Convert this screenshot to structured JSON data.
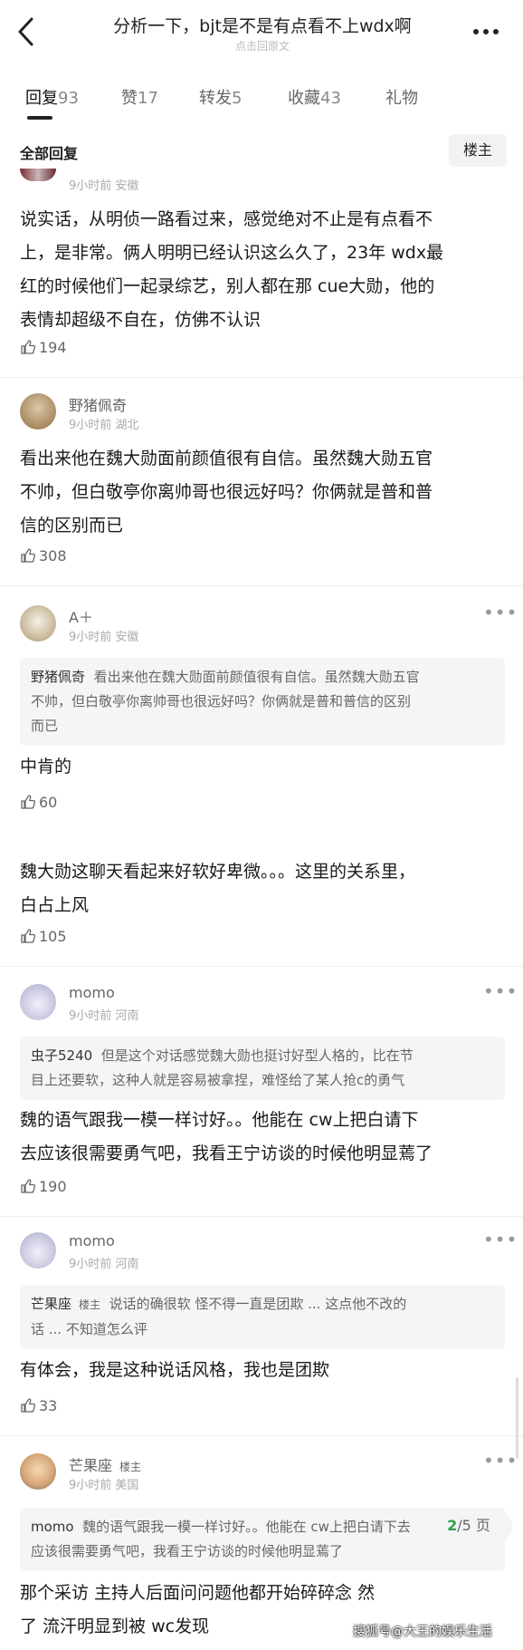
{
  "header": {
    "title": "分析一下，bjt是不是有点看不上wdx啊",
    "subtitle": "点击回原文"
  },
  "tabs": [
    {
      "label": "回复",
      "count": "93"
    },
    {
      "label": "赞",
      "count": "17"
    },
    {
      "label": "转发",
      "count": "5"
    },
    {
      "label": "收藏",
      "count": "43"
    },
    {
      "label": "礼物",
      "count": ""
    }
  ],
  "section": {
    "title": "全部回复",
    "louzhu_button": "楼主"
  },
  "comments": [
    {
      "meta": "9小时前 安徽",
      "lines": [
        "说实话，从明侦一路看过来，感觉绝对不止是有点看不",
        "上，是非常。俩人明明已经认识这么久了，23年 wdx最",
        "红的时候他们一起录综艺，别人都在那 cue大勋，他的",
        "表情却超级不自在，仿佛不认识"
      ],
      "likes": "194"
    },
    {
      "name": "野猪佩奇",
      "meta": "9小时前 湖北",
      "lines": [
        "看出来他在魏大勋面前颜值很有自信。虽然魏大勋五官",
        "不帅，但白敬亭你离帅哥也很远好吗？你俩就是普和普",
        "信的区别而已"
      ],
      "likes": "308"
    },
    {
      "name": "A＋",
      "meta": "9小时前 安徽",
      "quote_author": "野猪佩奇",
      "quote_lines": [
        "看出来他在魏大勋面前颜值很有自信。虽然魏大勋五官",
        "不帅，但白敬亭你离帅哥也很远好吗？你俩就是普和普信的区别",
        "而已"
      ],
      "lines": [
        "中肯的"
      ],
      "likes": "60"
    },
    {
      "lines": [
        "魏大勋这聊天看起来好软好卑微。。。这里的关系里，",
        "白占上风"
      ],
      "likes": "105"
    },
    {
      "name": "momo",
      "meta": "9小时前 河南",
      "quote_author": "虫子5240",
      "quote_lines": [
        "但是这个对话感觉魏大勋也挺讨好型人格的，比在节",
        "目上还要软，这种人就是容易被拿捏，难怪给了某人抢c的勇气"
      ],
      "lines": [
        "魏的语气跟我一模一样讨好。。他能在 cw上把白请下",
        "去应该很需要勇气吧，我看王宁访谈的时候他明显蔫了"
      ],
      "likes": "190"
    },
    {
      "name": "momo",
      "meta": "9小时前 河南",
      "quote_author": "芒果座",
      "quote_badge": "楼主",
      "quote_lines": [
        "说话的确很软 怪不得一直是团欺 ... 这点他不改的",
        "话 ... 不知道怎么评"
      ],
      "lines": [
        "有体会，我是这种说话风格，我也是团欺"
      ],
      "likes": "33"
    },
    {
      "name": "芒果座",
      "badge": "楼主",
      "meta": "9小时前 美国",
      "quote_author": "momo",
      "quote_lines": [
        "魏的语气跟我一模一样讨好。。他能在 cw上把白请下去",
        "应该很需要勇气吧，我看王宁访谈的时候他明显蔫了"
      ],
      "lines": [
        "那个采访 主持人后面问问题他都开始碎碎念 然",
        "了 流汗明显到被 wc发现"
      ]
    }
  ],
  "pager": {
    "current": "2",
    "total": "/5 页"
  },
  "watermark": "搜狐号@大王的娱乐生活",
  "colors": {
    "pager_current": "#2fa24a",
    "quote_bg": "#f5f5f5"
  }
}
